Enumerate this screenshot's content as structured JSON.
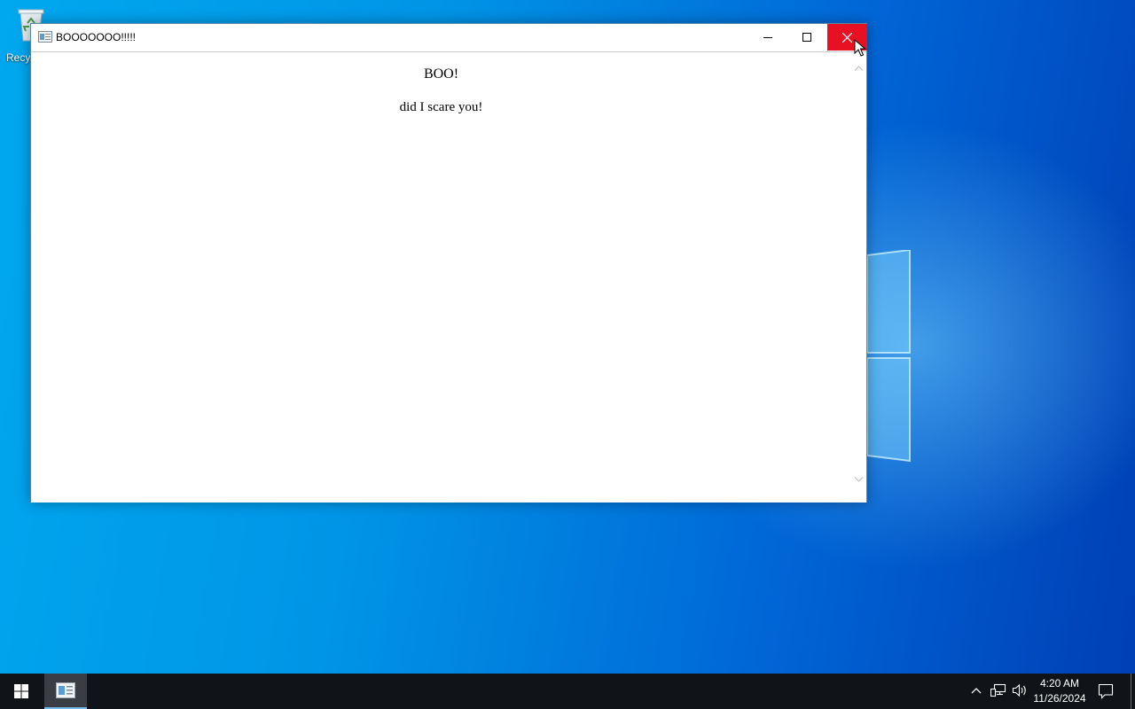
{
  "desktop": {
    "icons": [
      {
        "label": "Recy",
        "icon": "recycle-bin-icon"
      }
    ]
  },
  "window": {
    "title": "BOOOOOOO!!!!!",
    "content": {
      "heading": "BOO!",
      "paragraph": "did I scare you!"
    },
    "controls": {
      "minimize": "minimize-icon",
      "maximize": "maximize-icon",
      "close": "close-icon"
    }
  },
  "taskbar": {
    "start": "windows-logo-icon",
    "apps": [
      {
        "icon": "app-window-icon",
        "active": true
      }
    ],
    "tray": {
      "time": "4:20 AM",
      "date": "11/26/2024",
      "icons": [
        "chevron-up-icon",
        "network-icon",
        "volume-icon",
        "notification-icon"
      ]
    }
  },
  "colors": {
    "close_hover": "#e81123",
    "taskbar": "#101418",
    "desktop_accent": "#0078d7"
  }
}
